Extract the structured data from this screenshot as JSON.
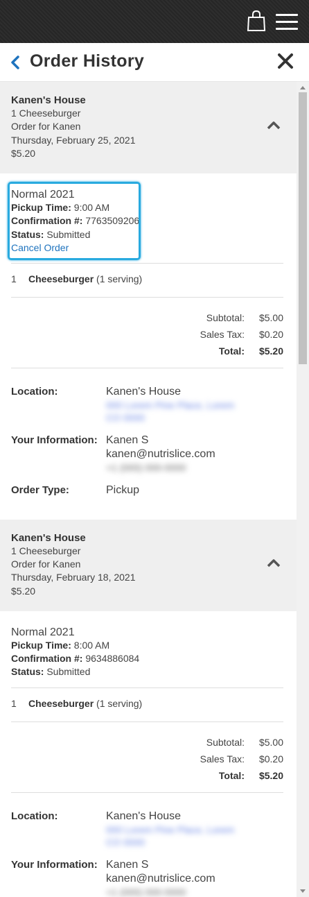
{
  "header": {
    "title": "Order History"
  },
  "icons": {
    "bag": "shopping-bag-icon",
    "menu": "hamburger-menu-icon",
    "back": "chevron-left-icon",
    "close": "close-icon",
    "collapse": "chevron-up-icon"
  },
  "labels": {
    "pickup_time": "Pickup Time:",
    "confirmation": "Confirmation #:",
    "status": "Status:",
    "cancel": "Cancel Order",
    "subtotal": "Subtotal:",
    "sales_tax": "Sales Tax:",
    "total": "Total:",
    "location": "Location:",
    "your_information": "Your Information:",
    "order_type": "Order Type:"
  },
  "orders": [
    {
      "location": "Kanen's House",
      "summary": "1 Cheeseburger",
      "order_for": "Order for Kanen",
      "date": "Thursday, February 25, 2021",
      "price": "$5.20",
      "plan": "Normal 2021",
      "pickup_time": "9:00 AM",
      "confirmation": "7763509206",
      "status": "Submitted",
      "items": [
        {
          "qty": "1",
          "name": "Cheeseburger",
          "serving": "(1 serving)"
        }
      ],
      "subtotal": "$5.00",
      "sales_tax": "$0.20",
      "total": "$5.20",
      "loc_name": "Kanen's House",
      "loc_address_1": "000 Lorem Pine Place, Lorem",
      "loc_address_2": "CO 0000",
      "customer_name": "Kanen S",
      "customer_email": "kanen@nutrislice.com",
      "customer_phone": "+1 (000) 000-0000",
      "order_type": "Pickup"
    },
    {
      "location": "Kanen's House",
      "summary": "1 Cheeseburger",
      "order_for": "Order for Kanen",
      "date": "Thursday, February 18, 2021",
      "price": "$5.20",
      "plan": "Normal 2021",
      "pickup_time": "8:00 AM",
      "confirmation": "9634886084",
      "status": "Submitted",
      "items": [
        {
          "qty": "1",
          "name": "Cheeseburger",
          "serving": "(1 serving)"
        }
      ],
      "subtotal": "$5.00",
      "sales_tax": "$0.20",
      "total": "$5.20",
      "loc_name": "Kanen's House",
      "loc_address_1": "000 Lorem Pine Place, Lorem",
      "loc_address_2": "CO 0000",
      "customer_name": "Kanen S",
      "customer_email": "kanen@nutrislice.com",
      "customer_phone": "+1 (000) 000-0000"
    }
  ]
}
